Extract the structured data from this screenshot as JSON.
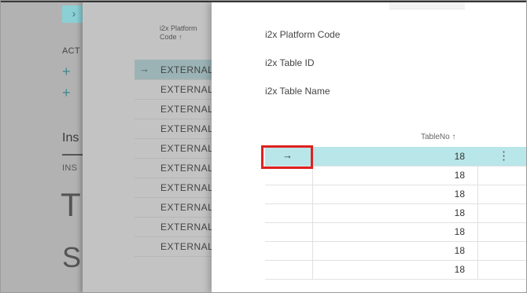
{
  "background": {
    "actions_label": "ACT",
    "insights_heading": "Ins",
    "insights_subheading": "INS",
    "large_letter_1": "T",
    "large_letter_2": "S"
  },
  "list_page": {
    "column_header_line1": "i2x Platform",
    "column_header_line2": "Code ↑",
    "rows": [
      "EXTERNAL",
      "EXTERNAL",
      "EXTERNAL",
      "EXTERNAL",
      "EXTERNAL",
      "EXTERNAL",
      "EXTERNAL",
      "EXTERNAL",
      "EXTERNAL",
      "EXTERNAL"
    ]
  },
  "card": {
    "fields": [
      "i2x Platform Code",
      "i2x Table ID",
      "i2x Table Name"
    ],
    "table_column_header": "TableNo ↑",
    "rows": [
      "18",
      "18",
      "18",
      "18",
      "18",
      "18",
      "18"
    ]
  },
  "icons": {
    "row_selector": "→",
    "more_options": "⋮",
    "add": "+",
    "back": "›"
  },
  "colors": {
    "selected_row": "#b9e6e8",
    "highlight_box": "#e02020",
    "accent": "#3f8a8e"
  }
}
